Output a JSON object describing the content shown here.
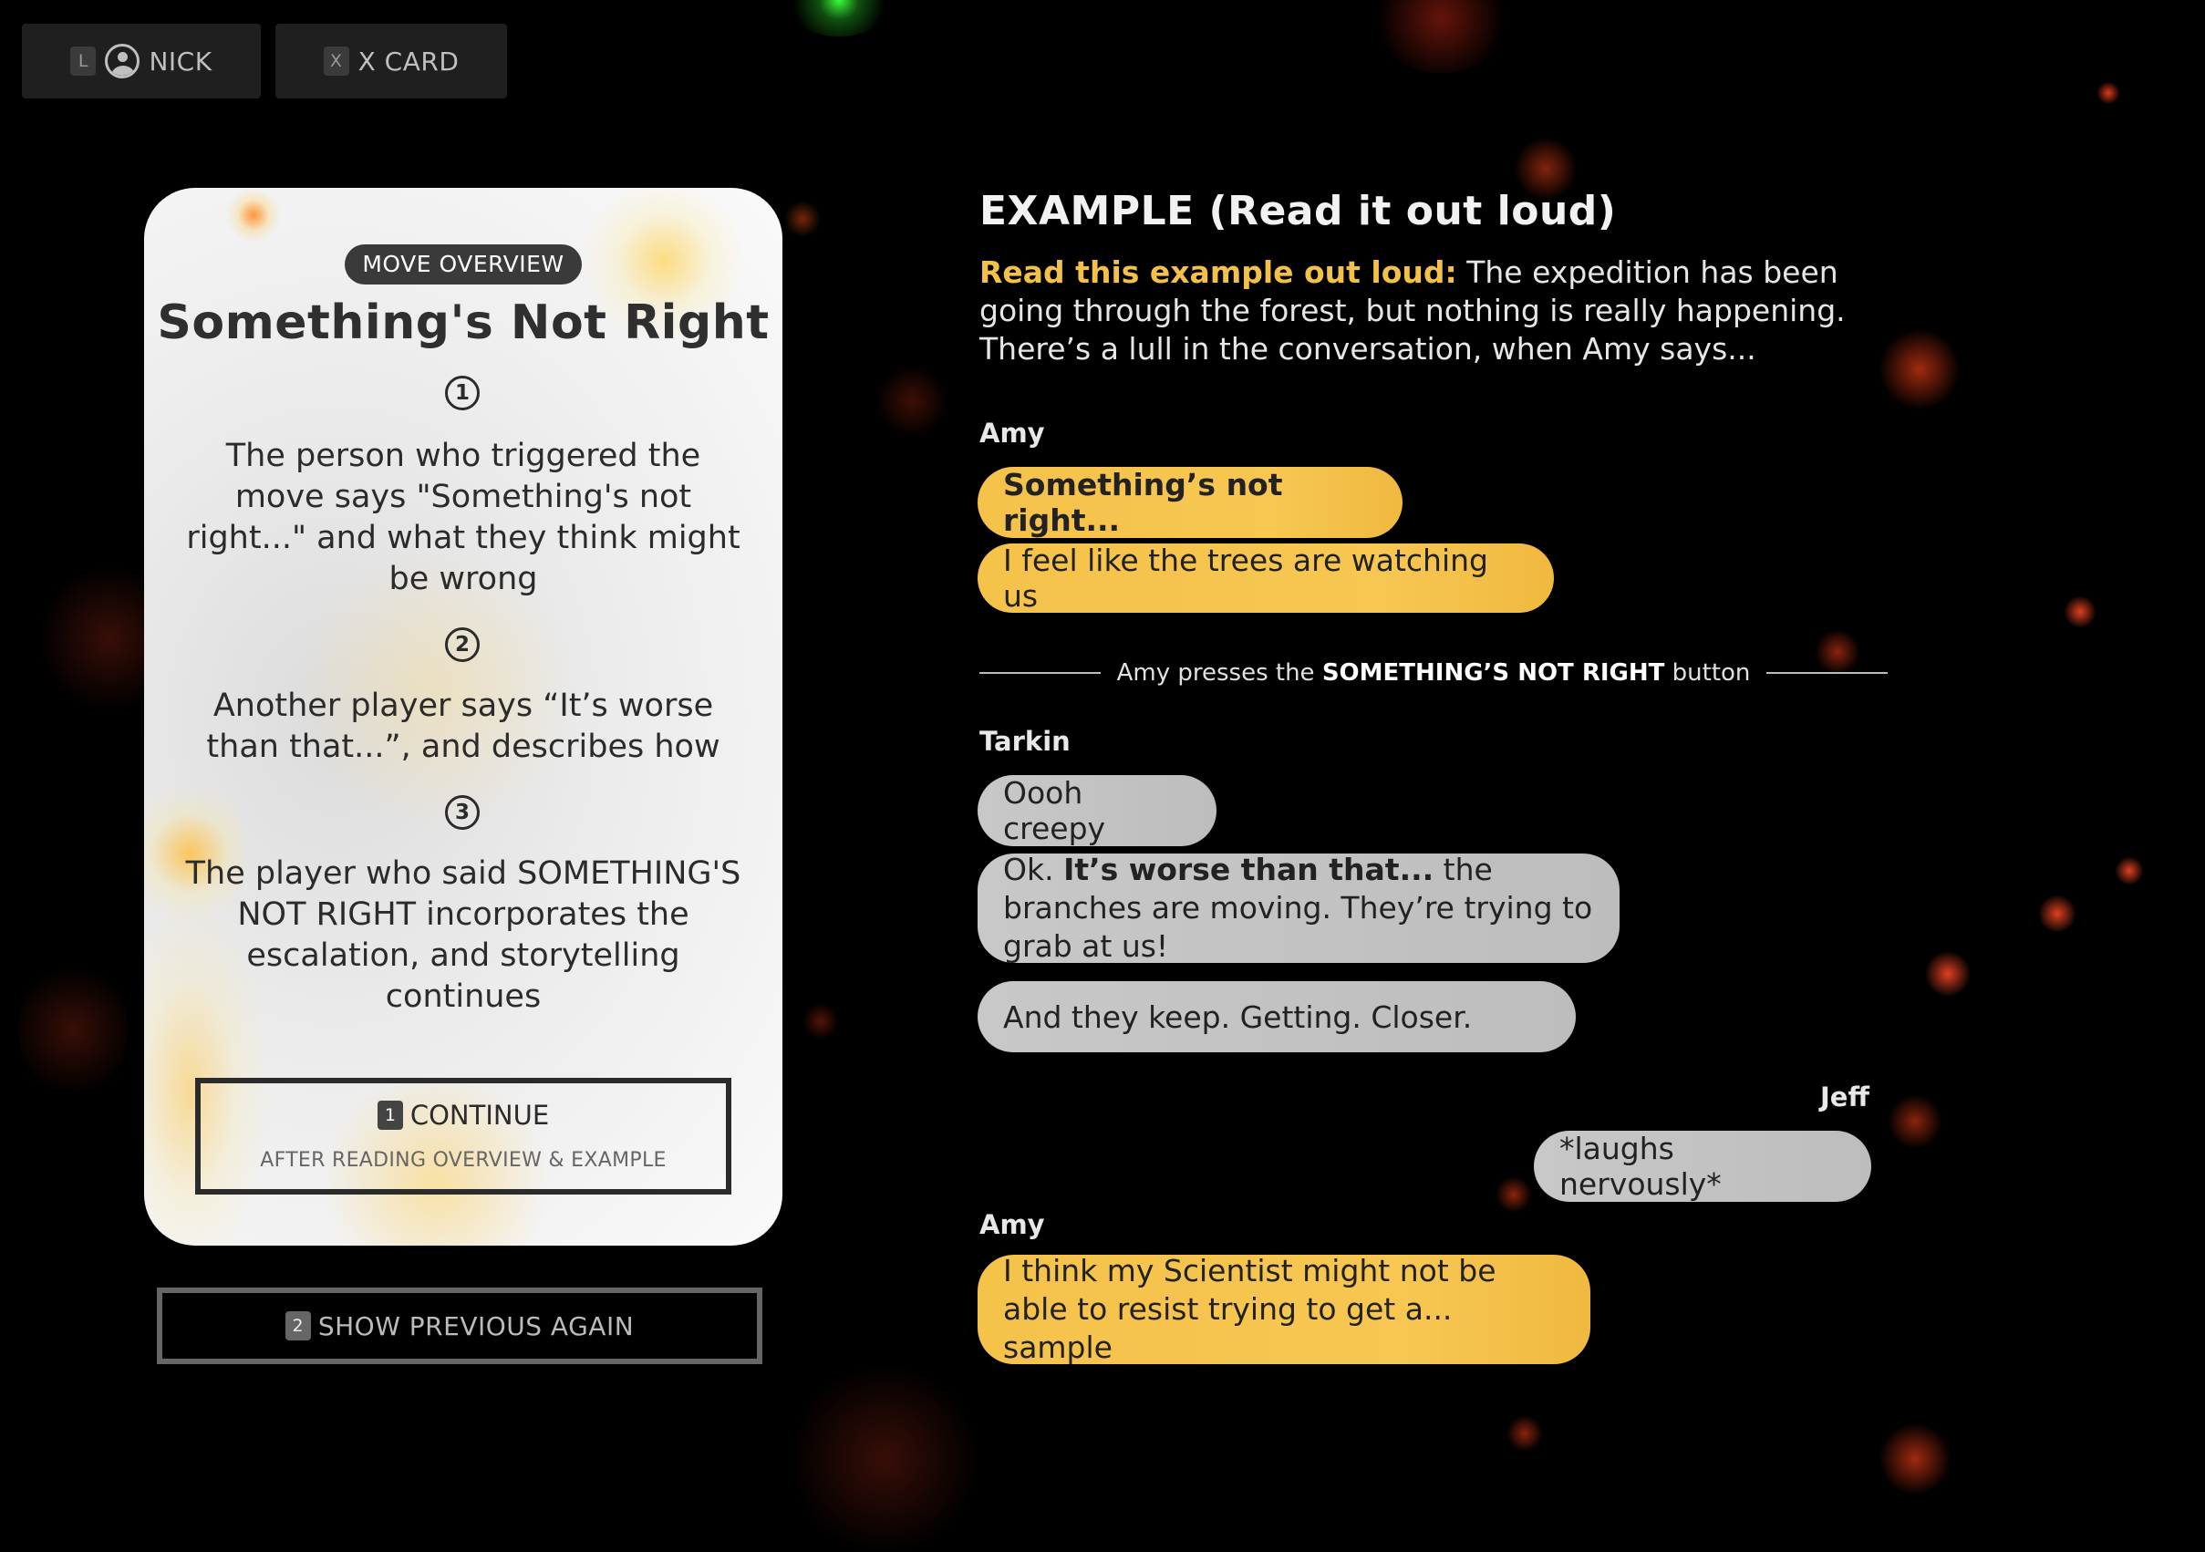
{
  "topbar": {
    "player": {
      "key": "L",
      "label": "NICK"
    },
    "xcard": {
      "key": "X",
      "label": "X CARD"
    }
  },
  "card": {
    "badge": "MOVE OVERVIEW",
    "title": "Something's Not Right",
    "steps": [
      {
        "num": "1",
        "text": "The person who triggered the move says \"Something's not right...\" and what they think might be wrong"
      },
      {
        "num": "2",
        "text": "Another player says “It’s worse than that...”, and describes how"
      },
      {
        "num": "3",
        "text": "The player who said SOMETHING'S NOT RIGHT incorporates the escalation, and storytelling continues"
      }
    ],
    "continue": {
      "key": "1",
      "label": "CONTINUE",
      "sub": "AFTER READING OVERVIEW & EXAMPLE"
    }
  },
  "previous": {
    "key": "2",
    "label": "SHOW PREVIOUS AGAIN"
  },
  "example": {
    "title": "EXAMPLE (Read it out loud)",
    "intro_highlight": "Read this example out loud:",
    "intro_text": " The expedition has been going through the forest, but nothing is really happening. There’s a lull in the conversation, when Amy says...",
    "divider_pre": "Amy presses the ",
    "divider_bold": "SOMETHING’S NOT RIGHT",
    "divider_post": " button",
    "speakers": {
      "amy1": "Amy",
      "tarkin": "Tarkin",
      "jeff": "Jeff",
      "amy2": "Amy"
    },
    "messages": {
      "amy1a": "Something’s not right...",
      "amy1b": "I feel like the trees are watching us",
      "tarkin1": "Oooh creepy",
      "tarkin2_pre": "Ok. ",
      "tarkin2_bold": "It’s worse than that...",
      "tarkin2_post": " the branches are moving. They’re trying to grab at us!",
      "tarkin3": "And they keep. Getting. Closer.",
      "jeff1": "*laughs nervously*",
      "amy2": "I think my Scientist might not be able to resist trying to get a... sample"
    }
  },
  "colors": {
    "background": "#000000",
    "yellow_bubble": "#f5c24a",
    "grey_bubble": "#c4c4c4",
    "highlight": "#f3c14a"
  }
}
